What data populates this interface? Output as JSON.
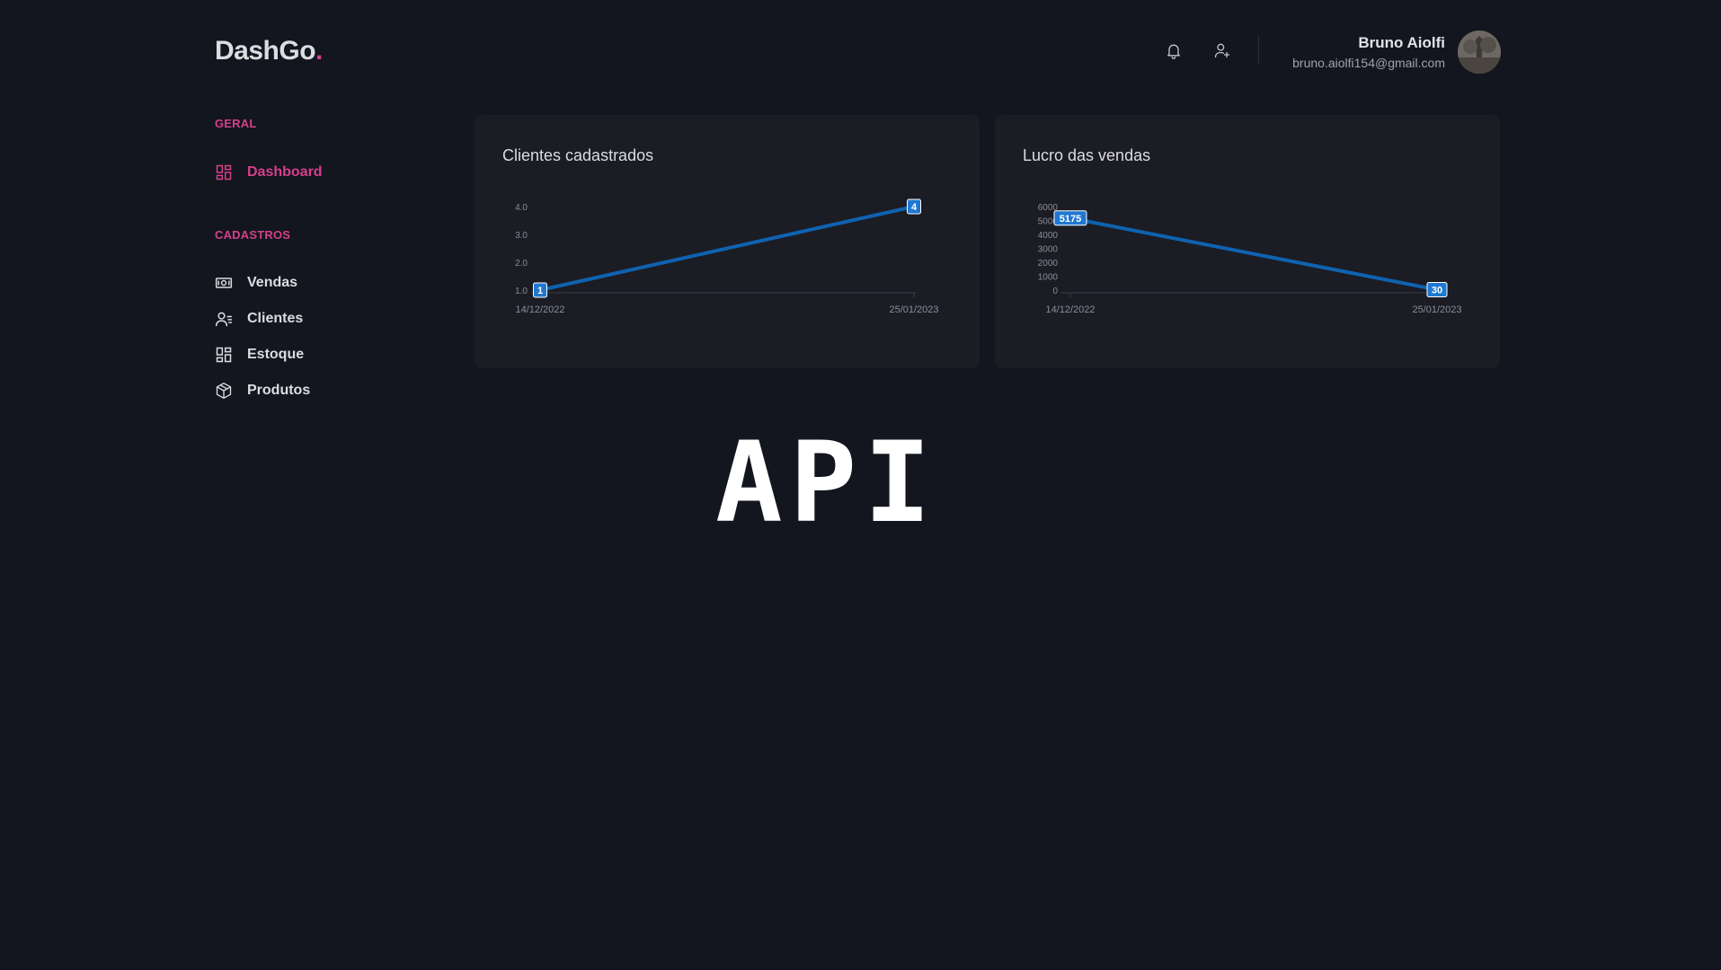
{
  "header": {
    "logo": "DashGo",
    "logo_dot": ".",
    "notifications_icon": "bell-icon",
    "add_user_icon": "user-plus-icon",
    "user": {
      "name": "Bruno Aiolfi",
      "email": "bruno.aiolfi154@gmail.com"
    }
  },
  "sidebar": {
    "sections": [
      {
        "title": "GERAL",
        "items": [
          {
            "label": "Dashboard",
            "icon": "dashboard-icon",
            "active": true
          }
        ]
      },
      {
        "title": "CADASTROS",
        "items": [
          {
            "label": "Vendas",
            "icon": "money-icon",
            "active": false
          },
          {
            "label": "Clientes",
            "icon": "users-list-icon",
            "active": false
          },
          {
            "label": "Estoque",
            "icon": "dashboard-icon",
            "active": false
          },
          {
            "label": "Produtos",
            "icon": "box-icon",
            "active": false
          }
        ]
      }
    ]
  },
  "colors": {
    "accent": "#d53f8c",
    "line": "#0f62b0",
    "background": "#13161e",
    "card": "#1b1c24"
  },
  "chart_data": [
    {
      "type": "line",
      "title": "Clientes cadastrados",
      "x": [
        "14/12/2022",
        "25/01/2023"
      ],
      "series": [
        {
          "values": [
            1,
            4
          ]
        }
      ],
      "yticks": [
        "1.0",
        "2.0",
        "3.0",
        "4.0"
      ],
      "ylim": [
        1,
        4
      ],
      "data_labels": [
        "1",
        "4"
      ]
    },
    {
      "type": "line",
      "title": "Lucro das vendas",
      "x": [
        "14/12/2022",
        "25/01/2023"
      ],
      "series": [
        {
          "values": [
            5175,
            30
          ]
        }
      ],
      "yticks": [
        "0",
        "1000",
        "2000",
        "3000",
        "4000",
        "5000",
        "6000"
      ],
      "ylim": [
        0,
        6000
      ],
      "data_labels": [
        "5175",
        "30"
      ]
    }
  ],
  "overlay_text": "API"
}
